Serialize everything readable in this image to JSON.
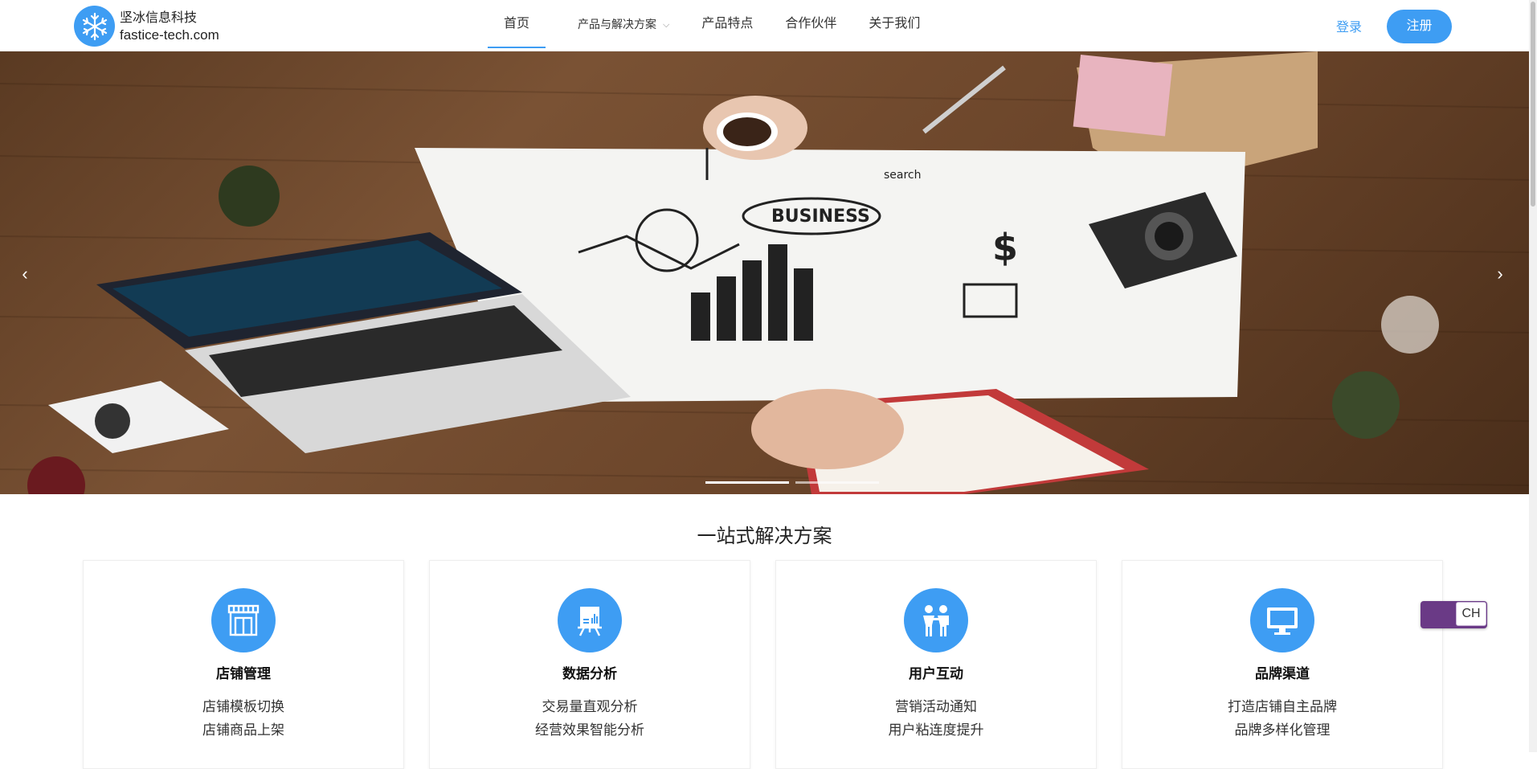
{
  "header": {
    "logo_cn": "坚冰信息科技",
    "logo_en": "fastice-tech.com",
    "logo_icon": "snowflake-icon",
    "nav": [
      {
        "label": "首页",
        "active": true
      },
      {
        "label": "产品与解决方案",
        "dropdown": true
      },
      {
        "label": "产品特点"
      },
      {
        "label": "合作伙伴"
      },
      {
        "label": "关于我们"
      }
    ],
    "login": "登录",
    "register": "注册"
  },
  "banner": {
    "prev_arrow": "‹",
    "next_arrow": "›",
    "active_slide": 1,
    "slide_count": 2,
    "sketch_word": "BUSINESS",
    "sketch_search": "search"
  },
  "section": {
    "title": "一站式解决方案",
    "cards": [
      {
        "icon": "storefront-icon",
        "title": "店铺管理",
        "lines": [
          "店铺模板切换",
          "店铺商品上架"
        ]
      },
      {
        "icon": "presentation-board-icon",
        "title": "数据分析",
        "lines": [
          "交易量直观分析",
          "经营效果智能分析"
        ]
      },
      {
        "icon": "two-people-icon",
        "title": "用户互动",
        "lines": [
          "营销活动通知",
          "用户粘连度提升"
        ]
      },
      {
        "icon": "monitor-icon",
        "title": "品牌渠道",
        "lines": [
          "打造店铺自主品牌",
          "品牌多样化管理"
        ]
      }
    ]
  },
  "lang_toggle": "CH",
  "colors": {
    "accent": "#3e9df3",
    "toggle": "#6a3a86"
  }
}
